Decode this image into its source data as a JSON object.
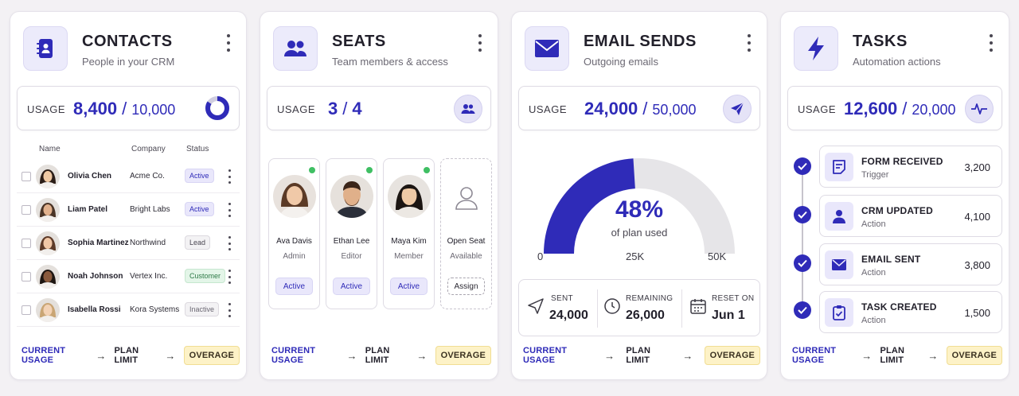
{
  "colors": {
    "accent": "#2f2bb8",
    "accent_light": "#e9e7fb",
    "overage_bg": "#fdf2c7",
    "online": "#3fbf63"
  },
  "footer": {
    "current": "CURRENT USAGE",
    "plan": "PLAN LIMIT",
    "overage": "OVERAGE",
    "arrow": "→"
  },
  "usage_label": "USAGE",
  "contacts": {
    "title": "CONTACTS",
    "subtitle": "People in your CRM",
    "icon": "address-book-icon",
    "usage": {
      "value": "8,400",
      "separator": "/",
      "limit": "10,000",
      "fraction": 0.84
    },
    "columns": [
      "Name",
      "Company",
      "Status"
    ],
    "rows": [
      {
        "name": "Olivia Chen",
        "company": "Acme Co.",
        "status": "Active",
        "status_type": "active"
      },
      {
        "name": "Liam Patel",
        "company": "Bright Labs",
        "status": "Active",
        "status_type": "active"
      },
      {
        "name": "Sophia Martinez",
        "company": "Northwind",
        "status": "Lead",
        "status_type": "lead"
      },
      {
        "name": "Noah Johnson",
        "company": "Vertex Inc.",
        "status": "Customer",
        "status_type": "customer"
      },
      {
        "name": "Isabella Rossi",
        "company": "Kora Systems",
        "status": "Inactive",
        "status_type": "inactive"
      }
    ]
  },
  "seats": {
    "title": "SEATS",
    "subtitle": "Team members & access",
    "icon": "users-icon",
    "usage": {
      "value": "3",
      "separator": "/",
      "limit": "4"
    },
    "members": [
      {
        "name": "Ava Davis",
        "role": "Admin",
        "button": "Active"
      },
      {
        "name": "Ethan Lee",
        "role": "Editor",
        "button": "Active"
      },
      {
        "name": "Maya Kim",
        "role": "Member",
        "button": "Active"
      }
    ],
    "open_seat": {
      "name": "Open Seat",
      "role": "Available",
      "button": "Assign"
    }
  },
  "email": {
    "title": "EMAIL SENDS",
    "subtitle": "Outgoing emails",
    "icon": "envelope-icon",
    "usage": {
      "value": "24,000",
      "separator": "/",
      "limit": "50,000"
    },
    "gauge": {
      "percent_text": "48%",
      "caption": "of plan used",
      "fraction": 0.48,
      "min": "0",
      "mid": "25K",
      "max": "50K"
    },
    "stats": [
      {
        "label": "SENT",
        "value": "24,000",
        "icon": "send-icon"
      },
      {
        "label": "REMAINING",
        "value": "26,000",
        "icon": "clock-icon"
      },
      {
        "label": "RESET ON",
        "value": "Jun 1",
        "icon": "calendar-icon"
      }
    ]
  },
  "tasks": {
    "title": "TASKS",
    "subtitle": "Automation actions",
    "icon": "lightning-icon",
    "usage": {
      "value": "12,600",
      "separator": "/",
      "limit": "20,000"
    },
    "items": [
      {
        "title": "FORM RECEIVED",
        "type": "Trigger",
        "count": "3,200",
        "icon": "form-icon"
      },
      {
        "title": "CRM UPDATED",
        "type": "Action",
        "count": "4,100",
        "icon": "person-icon"
      },
      {
        "title": "EMAIL SENT",
        "type": "Action",
        "count": "3,800",
        "icon": "envelope-icon"
      },
      {
        "title": "TASK CREATED",
        "type": "Action",
        "count": "1,500",
        "icon": "clipboard-icon"
      }
    ]
  }
}
